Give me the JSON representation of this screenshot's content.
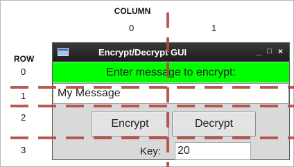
{
  "grid": {
    "column_heading": "COLUMN",
    "columns": [
      "0",
      "1"
    ],
    "row_heading": "ROW",
    "rows": [
      "0",
      "1",
      "2",
      "3"
    ]
  },
  "window": {
    "title": "Encrypt/Decrypt GUI",
    "controls": {
      "minimize": "_",
      "maximize": "□",
      "close": "×"
    }
  },
  "form": {
    "prompt": "Enter message to encrypt:",
    "message_value": "My Message",
    "encrypt_label": "Encrypt",
    "decrypt_label": "Decrypt",
    "key_label": "Key:",
    "key_value": "20"
  },
  "colors": {
    "prompt_background": "#00ff00",
    "grid_line": "#b34640",
    "titlebar": "#1f1f1f"
  },
  "icons": [
    "app-window-icon",
    "minimize-icon",
    "maximize-icon",
    "close-icon"
  ]
}
